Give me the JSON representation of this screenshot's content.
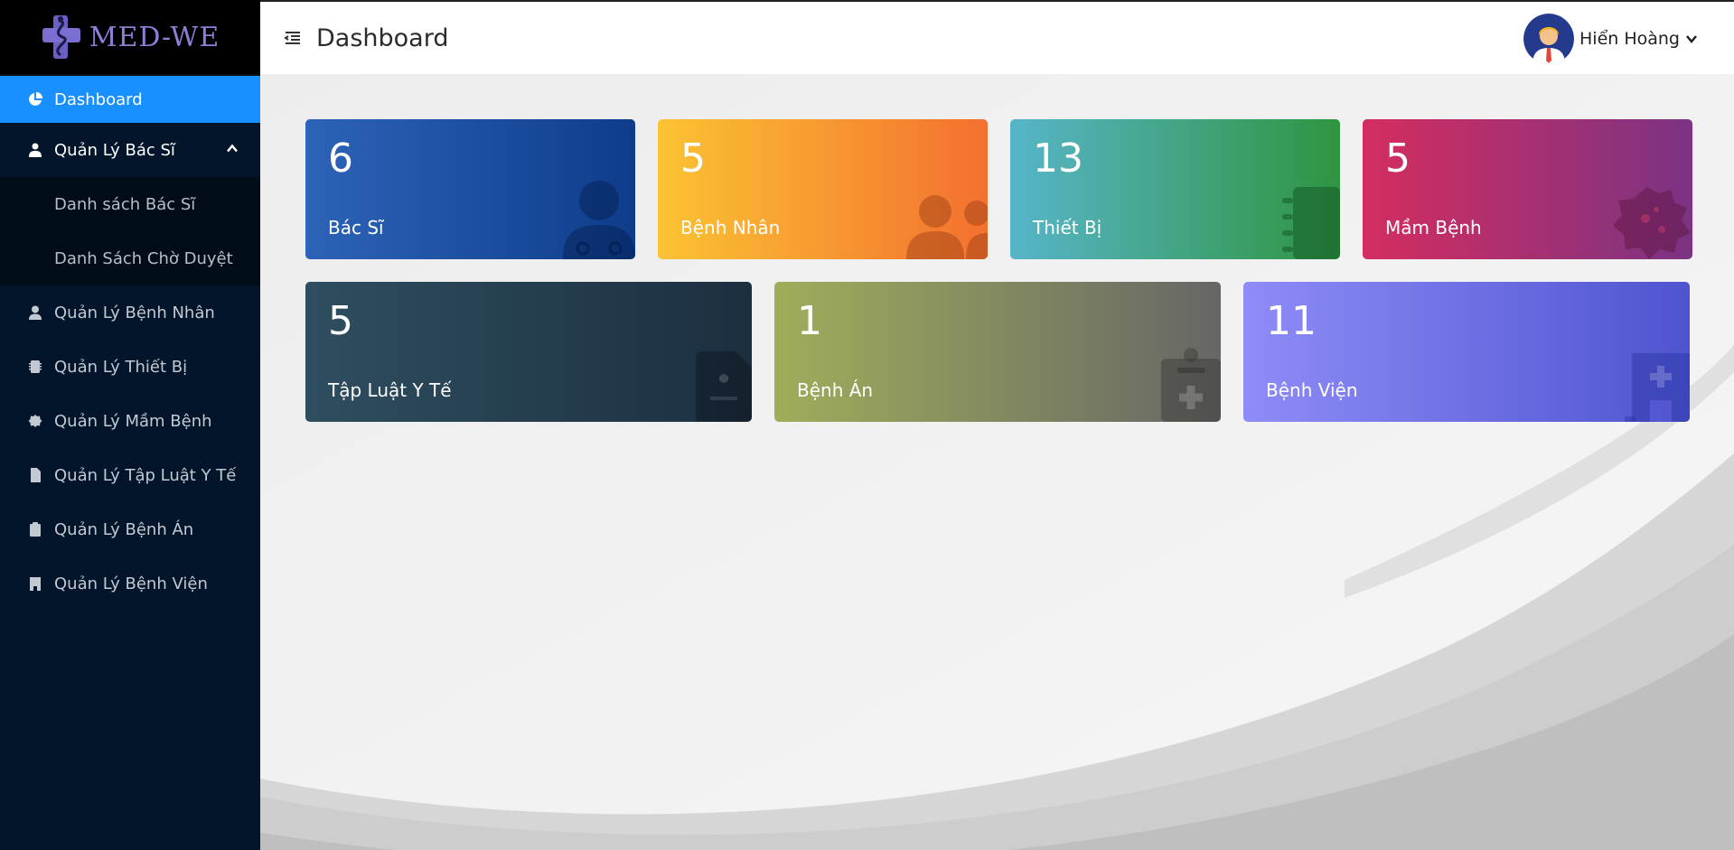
{
  "brand": {
    "name": "MED-WE"
  },
  "header": {
    "title": "Dashboard",
    "user_name": "Hiển Hoàng"
  },
  "sidebar": {
    "items": [
      {
        "label": "Dashboard",
        "icon": "pie-chart-icon",
        "active": true
      },
      {
        "label": "Quản Lý Bác Sĩ",
        "icon": "doctor-icon",
        "expanded": true,
        "children": [
          {
            "label": "Danh sách Bác Sĩ"
          },
          {
            "label": "Danh Sách Chờ Duyệt"
          }
        ]
      },
      {
        "label": "Quản Lý Bệnh Nhân",
        "icon": "user-icon"
      },
      {
        "label": "Quản Lý Thiết Bị",
        "icon": "device-icon"
      },
      {
        "label": "Quản Lý Mầm Bệnh",
        "icon": "virus-icon"
      },
      {
        "label": "Quản Lý Tập Luật Y Tế",
        "icon": "file-medical-icon"
      },
      {
        "label": "Quản Lý Bệnh Án",
        "icon": "clipboard-medical-icon"
      },
      {
        "label": "Quản Lý Bệnh Viện",
        "icon": "hospital-icon"
      }
    ]
  },
  "cards": [
    {
      "value": "6",
      "label": "Bác Sĩ",
      "icon": "doctor-icon",
      "colors": [
        "#2d63b8",
        "#0e3c8a"
      ]
    },
    {
      "value": "5",
      "label": "Bệnh Nhân",
      "icon": "users-icon",
      "colors": [
        "#fbc333",
        "#f3702f"
      ]
    },
    {
      "value": "13",
      "label": "Thiết Bị",
      "icon": "notebook-icon",
      "colors": [
        "#57b5c9",
        "#2f9540"
      ]
    },
    {
      "value": "5",
      "label": "Mầm Bệnh",
      "icon": "virus-icon",
      "colors": [
        "#d42d5f",
        "#7b3383"
      ]
    },
    {
      "value": "5",
      "label": "Tập Luật Y Tế",
      "icon": "file-medical-icon",
      "colors": [
        "#2e4e5f",
        "#1c2f40"
      ]
    },
    {
      "value": "1",
      "label": "Bệnh Án",
      "icon": "clipboard-medical-icon",
      "colors": [
        "#a0ad5a",
        "#666666"
      ]
    },
    {
      "value": "11",
      "label": "Bệnh Viện",
      "icon": "hospital-icon",
      "colors": [
        "#8f8cf8",
        "#4e54cf"
      ]
    }
  ],
  "colors": {
    "sidebar_bg": "#02152a",
    "active": "#1890ff",
    "submenu_bg": "#000c17"
  }
}
